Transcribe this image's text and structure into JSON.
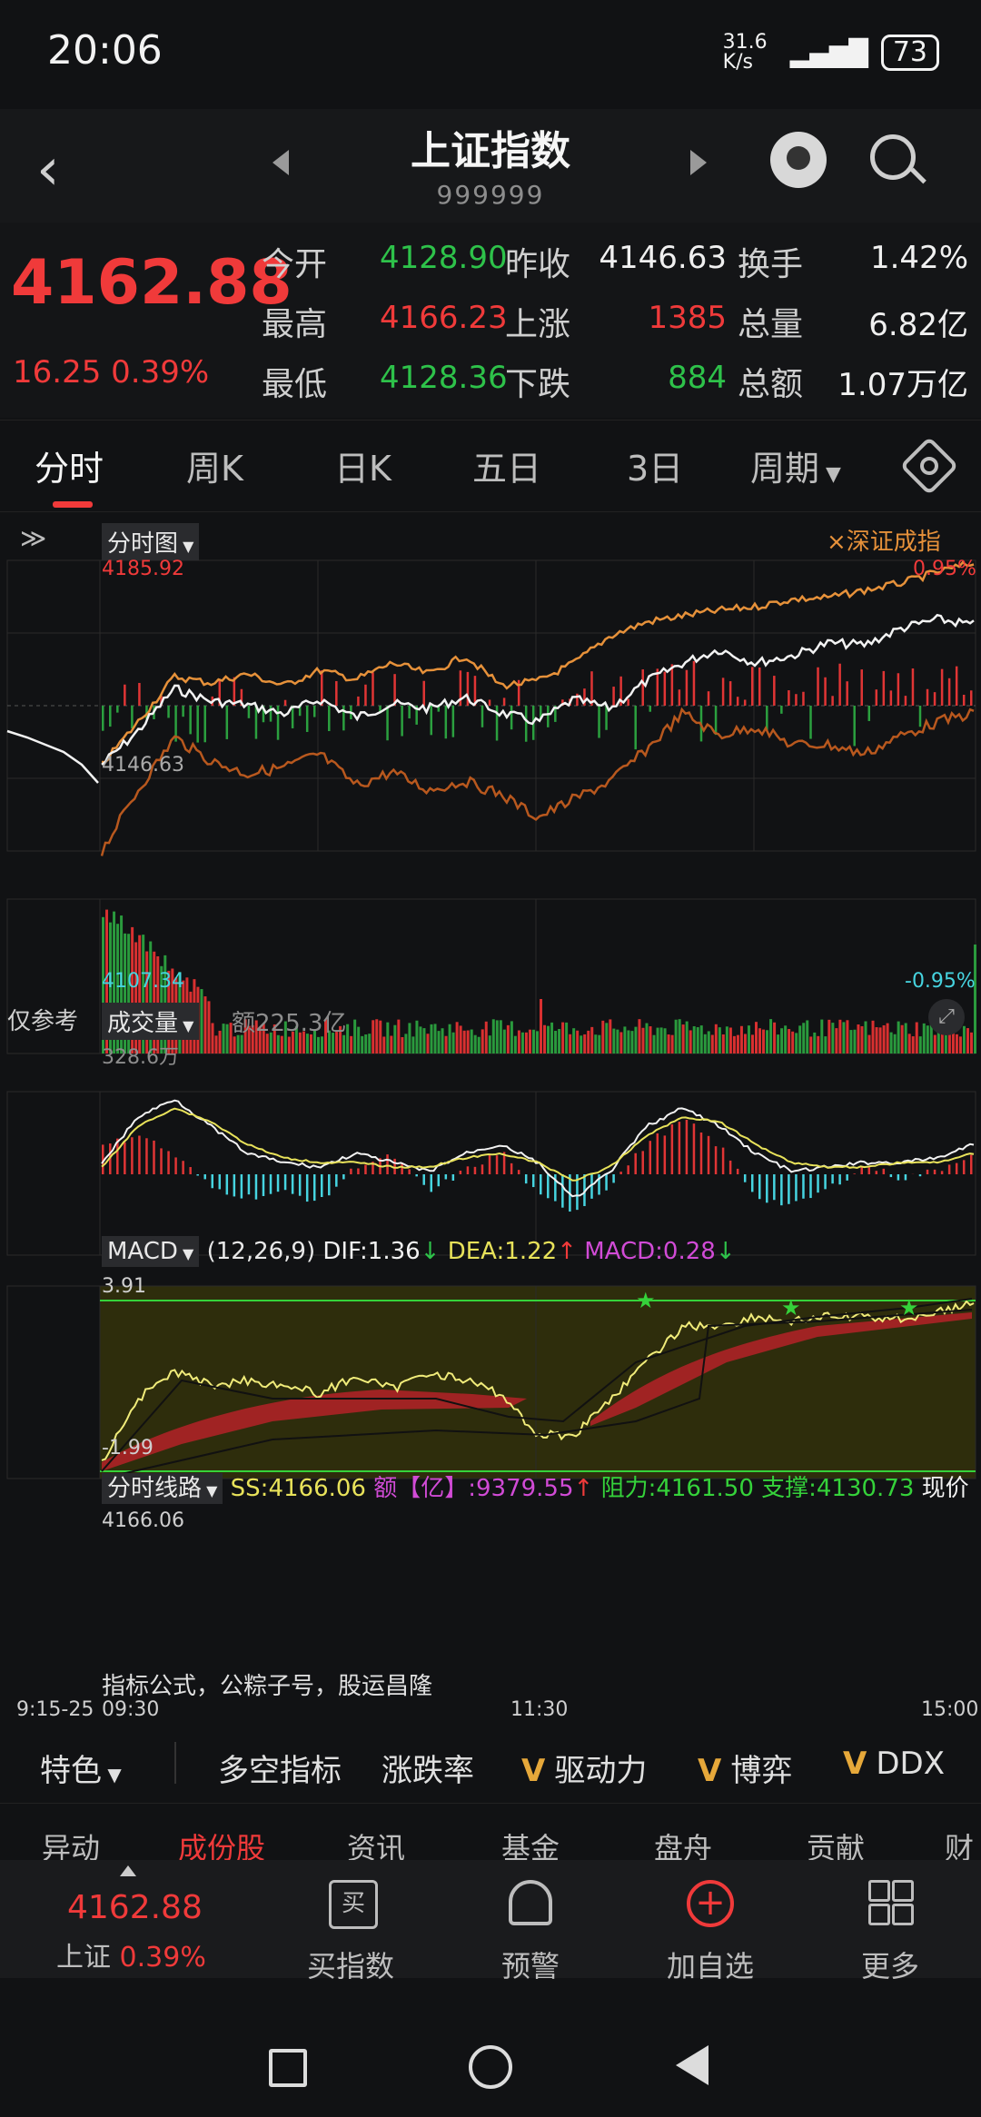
{
  "status_bar": {
    "time": "20:06",
    "net_speed": "31.6 K/s",
    "battery": "73"
  },
  "nav": {
    "title": "上证指数",
    "code": "999999"
  },
  "quote": {
    "price": "4162.88",
    "change": "16.25 0.39%",
    "rows": [
      [
        {
          "label": "今开",
          "value": "4128.90",
          "color": "green"
        },
        {
          "label": "昨收",
          "value": "4146.63",
          "color": "white"
        },
        {
          "label": "换手",
          "value": "1.42%",
          "color": "white"
        }
      ],
      [
        {
          "label": "最高",
          "value": "4166.23",
          "color": "red"
        },
        {
          "label": "上涨",
          "value": "1385",
          "color": "red"
        },
        {
          "label": "总量",
          "value": "6.82亿",
          "color": "white"
        }
      ],
      [
        {
          "label": "最低",
          "value": "4128.36",
          "color": "green"
        },
        {
          "label": "下跌",
          "value": "884",
          "color": "green"
        },
        {
          "label": "总额",
          "value": "1.07万亿",
          "color": "white"
        }
      ]
    ]
  },
  "tabs": [
    "分时",
    "周K",
    "日K",
    "五日",
    "3日",
    "周期"
  ],
  "main_chart": {
    "selector": "分时图",
    "compare": "×深证成指",
    "high": "4185.92",
    "mid": "4146.63",
    "low": "4107.34",
    "pct_high": "0.95%",
    "pct_low": "-0.95%",
    "note": "仅参考"
  },
  "volume_panel": {
    "selector": "成交量",
    "amount": "额225.3亿",
    "max": "328.6万"
  },
  "macd_panel": {
    "selector": "MACD",
    "params": "(12,26,9)",
    "dif": "DIF:1.36",
    "dea": "DEA:1.22",
    "macd": "MACD:0.28",
    "top": "3.91",
    "bottom": "-1.99"
  },
  "line_panel": {
    "selector": "分时线路",
    "ss": "SS:4166.06",
    "amt": "额【亿】:9379.55",
    "resist": "阻力:4161.50",
    "support": "支撑:4130.73",
    "now": "现价",
    "top": "4166.06",
    "formula": "指标公式，公粽子号，股运昌隆"
  },
  "time_axis": {
    "pre": "9:15-25",
    "start": "09:30",
    "mid": "11:30",
    "end": "15:00"
  },
  "features": {
    "special": "特色",
    "items": [
      "多空指标",
      "涨跌率",
      "驱动力",
      "博弈",
      "DDX"
    ],
    "v": "V"
  },
  "subtabs": [
    "异动",
    "成份股",
    "资讯",
    "基金",
    "盘舟",
    "贡献",
    "财"
  ],
  "bottom_bar": {
    "mini_price": "4162.88",
    "mini_label": "上证",
    "mini_pct": "0.39%",
    "buy": "买指数",
    "alert": "预警",
    "add": "加自选",
    "more": "更多"
  },
  "colors": {
    "up": "#f03a3a",
    "down": "#2ec24a",
    "accent": "#e6a83a"
  }
}
